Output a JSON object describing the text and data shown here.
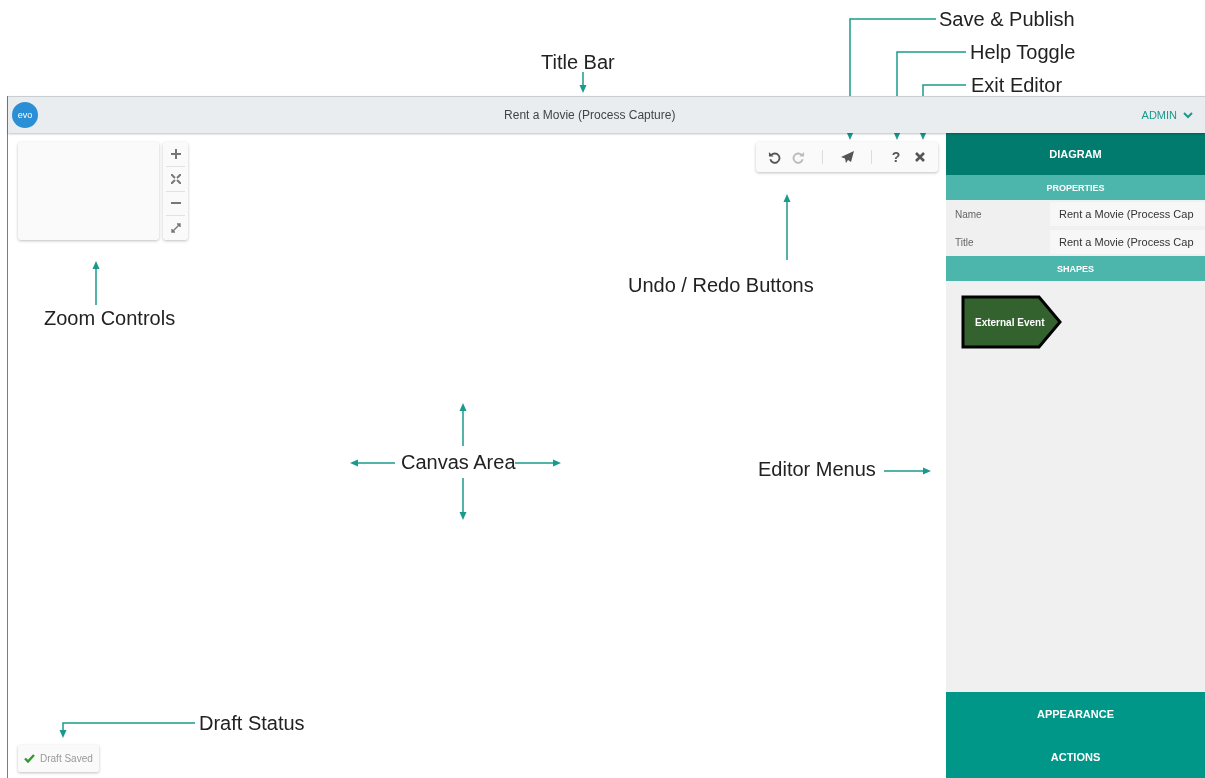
{
  "annotations": [
    {
      "text": "Title Bar"
    },
    {
      "text": "Save & Publish"
    },
    {
      "text": "Help Toggle"
    },
    {
      "text": "Exit Editor"
    },
    {
      "text": "Undo / Redo Buttons"
    },
    {
      "text": "Zoom Controls"
    },
    {
      "text": "Canvas Area"
    },
    {
      "text": "Editor Menus"
    },
    {
      "text": "Draft Status"
    }
  ],
  "title_bar": {
    "logo": "evo",
    "title": "Rent a Movie (Process Capture)",
    "user_menu": "ADMIN"
  },
  "zoom_controls": [
    {
      "kind": "zoom_in"
    },
    {
      "kind": "fit"
    },
    {
      "kind": "zoom_out"
    },
    {
      "kind": "expand"
    }
  ],
  "toolbar": [
    {
      "kind": "undo",
      "disabled": false
    },
    {
      "kind": "redo",
      "disabled": true
    },
    {
      "kind": "publish",
      "disabled": false
    },
    {
      "kind": "help",
      "label": "?",
      "disabled": false
    },
    {
      "kind": "exit",
      "disabled": false
    }
  ],
  "draft_status": "Draft Saved",
  "editor_panel": {
    "header": "DIAGRAM",
    "properties_heading": "PROPERTIES",
    "properties": [
      {
        "label": "Name",
        "value": "Rent a Movie (Process Cap"
      },
      {
        "label": "Title",
        "value": "Rent a Movie (Process Cap"
      }
    ],
    "shapes_heading": "SHAPES",
    "shapes": [
      {
        "label": "External Event"
      }
    ],
    "menus": [
      "APPEARANCE",
      "ACTIONS"
    ]
  }
}
